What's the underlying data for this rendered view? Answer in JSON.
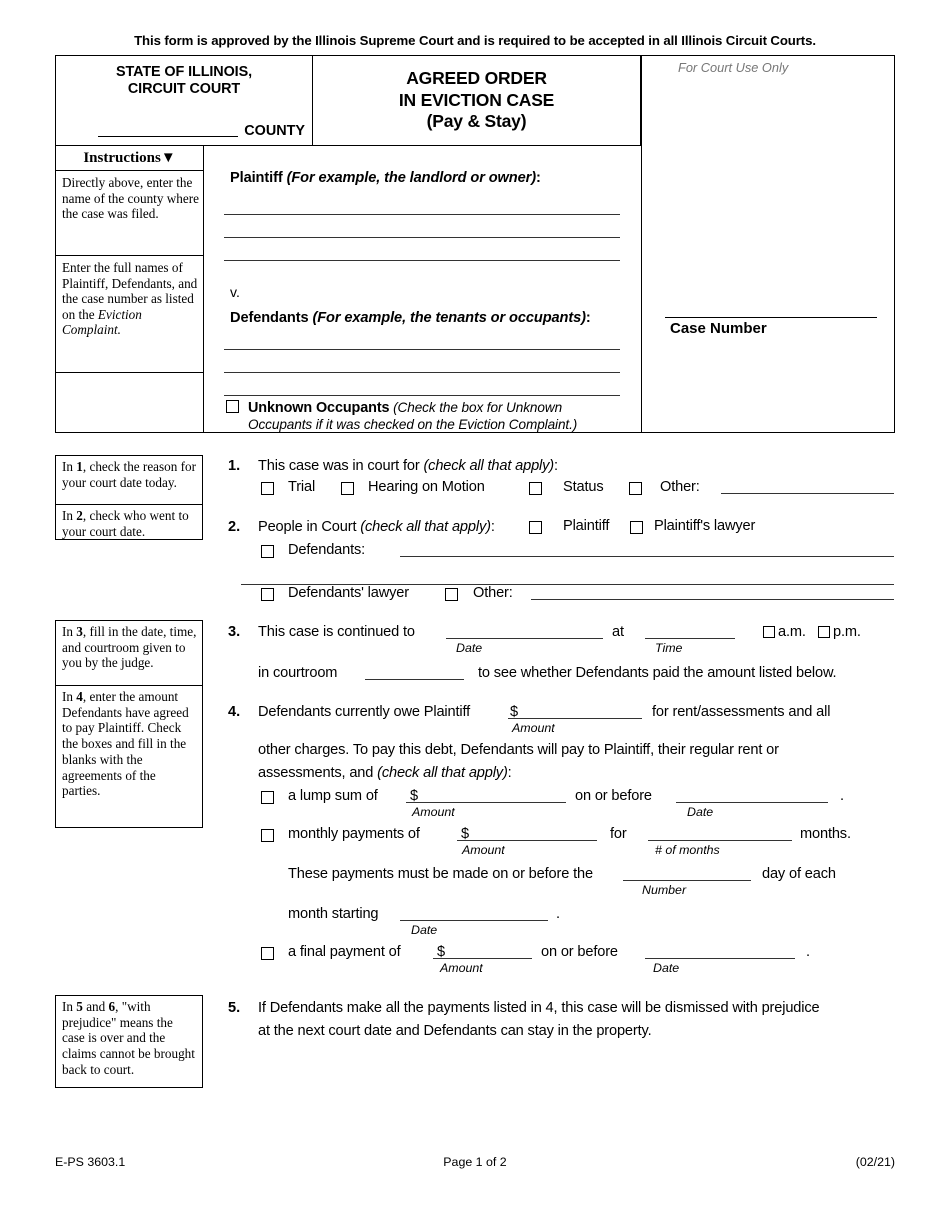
{
  "document": {
    "approval_notice": "This form is approved by the Illinois Supreme Court and is required to be accepted in all Illinois Circuit Courts."
  },
  "caption": {
    "state_line1": "STATE OF ILLINOIS,",
    "state_line2": "CIRCUIT COURT",
    "county_label": "COUNTY",
    "title_line1": "AGREED ORDER",
    "title_line2": "IN EVICTION CASE",
    "title_line3": "(Pay & Stay)",
    "court_use_only": "For Court Use Only",
    "case_number_label": "Case Number"
  },
  "instructions": {
    "header": "Instructions",
    "chevron_icon": "▼",
    "cells": [
      "Directly above, enter the name of the county where the case was filed.",
      "Enter the full names of Plaintiff, Defendants, and the case number as listed on the ",
      ""
    ],
    "cell2_italic_tail": "Eviction Complaint."
  },
  "parties": {
    "plaintiff_label": "Plaintiff",
    "plaintiff_hint": "(For example, the landlord or owner)",
    "versus": "v.",
    "defendants_label": "Defendants",
    "defendants_hint": "(For example, the tenants or occupants)",
    "unknown_occupants_label": "Unknown Occupants",
    "unknown_occupants_hint_line1": "(Check the box for Unknown",
    "unknown_occupants_hint_line2": "Occupants if it was checked on the Eviction Complaint.)"
  },
  "notes": [
    {
      "prefix": "In ",
      "num": "1",
      "text": ", check the reason for your court date today."
    },
    {
      "prefix": "In ",
      "num": "2",
      "text": ", check who went to your court date."
    },
    {
      "prefix": "In ",
      "num": "3",
      "text": ", fill in the date, time, and courtroom given to you by the judge."
    },
    {
      "prefix": "In ",
      "num": "4",
      "text": ", enter the amount Defendants have agreed to pay Plaintiff. Check the boxes and fill in the blanks with the agreements of the parties."
    },
    {
      "prefix": "In ",
      "num": "5",
      "mid": " and ",
      "num2": "6",
      "text": ", \"with prejudice\" means the case is over and the claims cannot be brought back to court."
    }
  ],
  "items": {
    "item1": {
      "number": "1.",
      "text": "This case was in court for ",
      "hint": "(check all that apply)",
      "colon": ":",
      "options": [
        "Trial",
        "Hearing on Motion",
        "Status",
        "Other:"
      ]
    },
    "item2": {
      "number": "2.",
      "text": "People in Court ",
      "hint": "(check all that apply)",
      "colon": ":",
      "opt_plaintiff": "Plaintiff",
      "opt_plaintiff_lawyer": "Plaintiff's lawyer",
      "opt_defendants": "Defendants:",
      "opt_defendants_lawyer": "Defendants' lawyer",
      "opt_other": "Other:"
    },
    "item3": {
      "number": "3.",
      "text_a": "This case is continued to",
      "text_at": "at",
      "label_date": "Date",
      "label_time": "Time",
      "am": "a.m.",
      "pm": "p.m.",
      "text_courtroom": "in courtroom",
      "text_tail": "to see whether Defendants paid the amount listed below."
    },
    "item4": {
      "number": "4.",
      "line1_a": "Defendants currently owe Plaintiff",
      "dollar": "$",
      "line1_b": "for rent/assessments and all",
      "label_amount": "Amount",
      "line2": "other charges. To pay this debt, Defendants will pay to Plaintiff, their regular rent or",
      "line3_a": "assessments, and ",
      "line3_hint": "(check all that apply)",
      "line3_colon": ":",
      "lump": {
        "text": "a lump sum of",
        "dollar": "$",
        "on_or_before": "on or before",
        "label_amount": "Amount",
        "label_date": "Date",
        "period": "."
      },
      "monthly": {
        "text": "monthly payments of",
        "dollar": "$",
        "for": "for",
        "months": "months.",
        "label_amount": "Amount",
        "label_months": "# of months",
        "line2_a": "These payments must be made on or before the",
        "line2_b": "day of each",
        "label_number": "Number",
        "line3_a": "month starting",
        "label_date": "Date",
        "period": "."
      },
      "final": {
        "text": "a final payment of",
        "dollar": "$",
        "on_or_before": "on or before",
        "label_amount": "Amount",
        "label_date": "Date",
        "period": "."
      }
    },
    "item5": {
      "number": "5.",
      "line1": "If Defendants make all the payments listed in 4, this case will be dismissed with prejudice",
      "line2": "at the next court date and Defendants can stay in the property."
    }
  },
  "footer": {
    "form_id": "E-PS 3603.1",
    "page": "Page 1 of 2",
    "revision": "(02/21)"
  }
}
